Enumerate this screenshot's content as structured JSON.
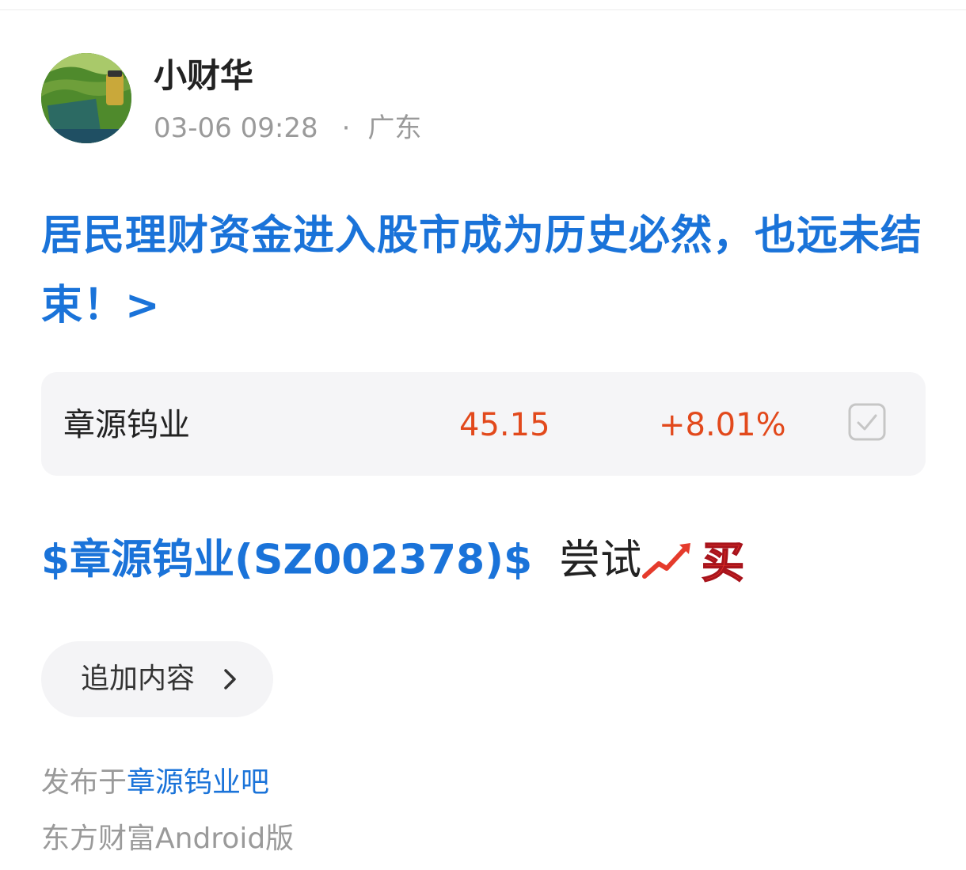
{
  "author": {
    "name": "小财华",
    "time": "03-06 09:28",
    "separator": "·",
    "location": "广东"
  },
  "post": {
    "title": "居民理财资金进入股市成为历史必然，也远未结束！>",
    "body_stock_tag": "$章源钨业(SZ002378)$",
    "body_text": "尝试",
    "body_icons": [
      "chart-increasing-icon",
      "buy-emoji-icon"
    ],
    "buy_icon_char": "买"
  },
  "stock_card": {
    "name": "章源钨业",
    "price": "45.15",
    "change": "+8.01%",
    "price_color": "#e2491c",
    "watch_icon": "checkbox-checked-icon"
  },
  "actions": {
    "append_label": "追加内容",
    "append_icon": "chevron-right-icon"
  },
  "footer": {
    "published_prefix": "发布于",
    "forum_name": "章源钨业吧",
    "client": "东方财富Android版"
  },
  "colors": {
    "link_blue": "#1a73d9",
    "up_red": "#e2491c",
    "meta_gray": "#9a9a9a"
  }
}
